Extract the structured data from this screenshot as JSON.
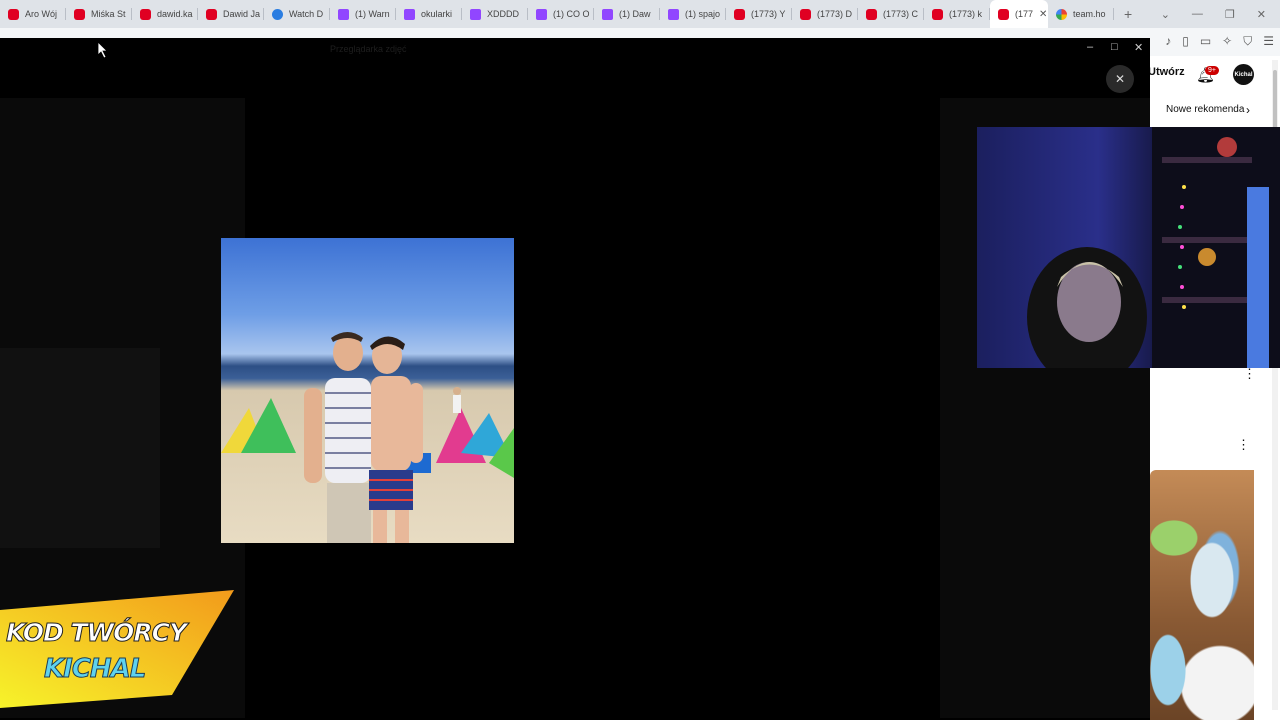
{
  "browser": {
    "tabs": [
      {
        "label": "Aro Wój",
        "icon": "youtube-icon",
        "type": "yt"
      },
      {
        "label": "Miśka St",
        "icon": "youtube-icon",
        "type": "yt"
      },
      {
        "label": "dawid.ka",
        "icon": "youtube-icon",
        "type": "yt"
      },
      {
        "label": "Dawid Ja",
        "icon": "youtube-icon",
        "type": "yt"
      },
      {
        "label": "Watch D",
        "icon": "watch-icon",
        "type": "watch"
      },
      {
        "label": "(1) Warn",
        "icon": "twitch-icon",
        "type": "tw"
      },
      {
        "label": "okularki",
        "icon": "twitch-icon",
        "type": "tw"
      },
      {
        "label": "XDDDD",
        "icon": "twitch-icon",
        "type": "tw"
      },
      {
        "label": "(1) CO O",
        "icon": "twitch-icon",
        "type": "tw"
      },
      {
        "label": "(1) Daw",
        "icon": "twitch-icon",
        "type": "tw"
      },
      {
        "label": "(1) spajo",
        "icon": "twitch-icon",
        "type": "tw"
      },
      {
        "label": "(1773) Y",
        "icon": "youtube-icon",
        "type": "yt"
      },
      {
        "label": "(1773) D",
        "icon": "youtube-icon",
        "type": "yt"
      },
      {
        "label": "(1773) C",
        "icon": "youtube-icon",
        "type": "yt"
      },
      {
        "label": "(1773) k",
        "icon": "youtube-icon",
        "type": "yt"
      },
      {
        "label": "(177",
        "icon": "youtube-icon",
        "type": "yt",
        "active": true
      },
      {
        "label": "team.ho",
        "icon": "google-icon",
        "type": "g"
      }
    ],
    "new_tab": "+",
    "window_controls": {
      "minimize": "⌄",
      "maximize": "—",
      "restore": "❐",
      "close": "✕"
    }
  },
  "viewer": {
    "title": "Przeglądarka zdjęć",
    "controls": {
      "minimize": "–",
      "maximize": "□",
      "close": "✕"
    },
    "close_button": "✕"
  },
  "youtube": {
    "create_label": "Utwórz",
    "notification_count": "9+",
    "avatar_label": "Kichal",
    "chip_label": "Nowe rekomenda",
    "more_icon": "⋮"
  },
  "promo": {
    "line1": "KOD TWÓRCY",
    "line2": "KICHAL",
    "colors": {
      "gradient_start": "#f7f32a",
      "gradient_end": "#f29a1b",
      "line2": "#5fd2ee"
    }
  }
}
